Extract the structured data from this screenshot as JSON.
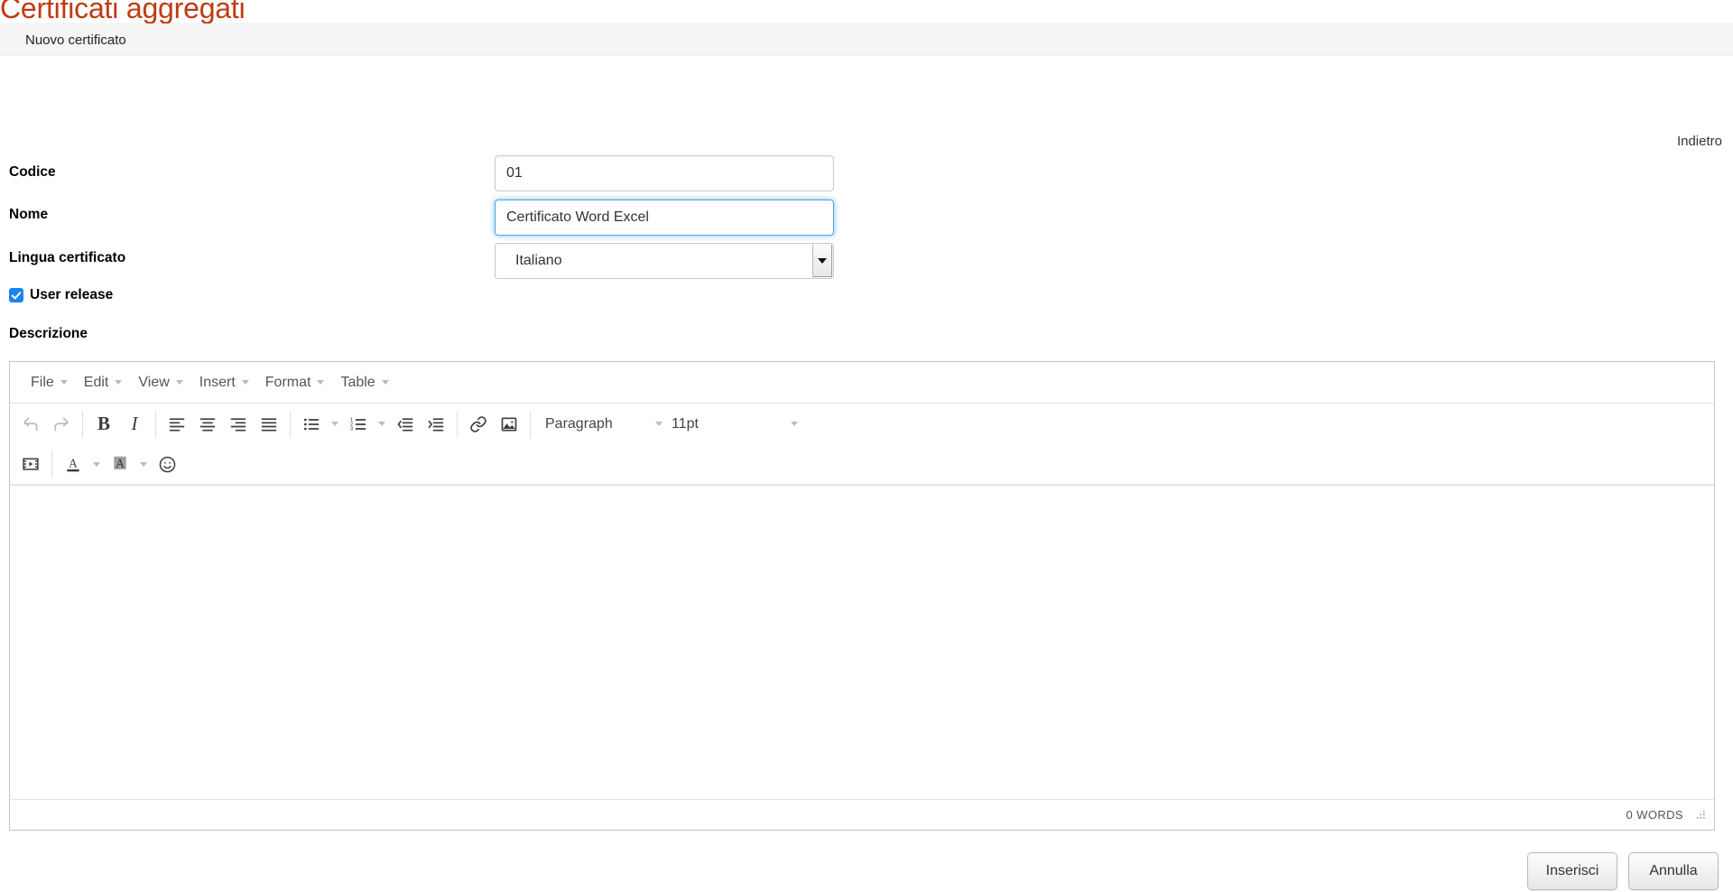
{
  "header": {
    "title": "Certificati aggregati",
    "breadcrumb": "Nuovo certificato"
  },
  "nav": {
    "back_label": "Indietro"
  },
  "form": {
    "codice": {
      "label": "Codice",
      "value": "01"
    },
    "nome": {
      "label": "Nome",
      "value": "Certificato Word Excel"
    },
    "lingua": {
      "label": "Lingua certificato",
      "value": "Italiano"
    },
    "user_release": {
      "label": "User release",
      "checked": true
    },
    "descrizione": {
      "label": "Descrizione"
    }
  },
  "editor": {
    "menus": [
      {
        "label": "File"
      },
      {
        "label": "Edit"
      },
      {
        "label": "View"
      },
      {
        "label": "Insert"
      },
      {
        "label": "Format"
      },
      {
        "label": "Table"
      }
    ],
    "format_select": "Paragraph",
    "fontsize_select": "11pt",
    "content": "",
    "wordcount": "0 WORDS"
  },
  "footer": {
    "submit_label": "Inserisci",
    "cancel_label": "Annulla"
  },
  "colors": {
    "title": "#bf3b12",
    "focus_border": "#4da3e0",
    "checkbox": "#1a84f0"
  }
}
